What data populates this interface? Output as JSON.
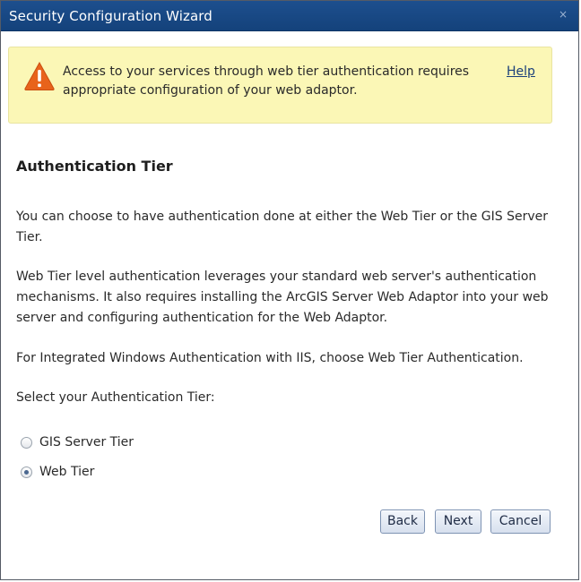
{
  "window": {
    "title": "Security Configuration Wizard",
    "close_glyph": "×"
  },
  "warning": {
    "icon": "warning-triangle-icon",
    "text": "Access to your services through web tier authentication requires appropriate configuration of your web adaptor.",
    "help_link": "Help"
  },
  "content": {
    "heading": "Authentication Tier",
    "paragraphs": [
      "You can choose to have authentication done at either the Web Tier or the GIS Server Tier.",
      "Web Tier level authentication leverages your standard web server's authentication mechanisms. It also requires installing the ArcGIS Server Web Adaptor into your web server and configuring authentication for the Web Adaptor.",
      "For Integrated Windows Authentication with IIS, choose Web Tier Authentication.",
      "Select your Authentication Tier:"
    ]
  },
  "tier_options": {
    "selected": "Web Tier",
    "items": [
      {
        "label": "GIS Server Tier",
        "checked": false
      },
      {
        "label": "Web Tier",
        "checked": true
      }
    ]
  },
  "buttons": {
    "back": "Back",
    "next": "Next",
    "cancel": "Cancel"
  },
  "colors": {
    "titlebar": "#1a4a88",
    "warning_background": "#fbf7b6",
    "warning_icon": "#e8631b",
    "link": "#1a3f7a"
  }
}
